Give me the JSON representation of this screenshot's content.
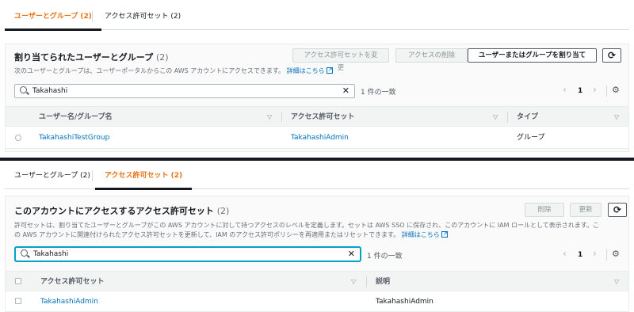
{
  "top": {
    "tabs": [
      {
        "label": "ユーザーとグループ (2)",
        "active": true
      },
      {
        "label": "アクセス許可セット (2)",
        "active": false
      }
    ],
    "title": "割り当てられたユーザーとグループ",
    "title_count": "(2)",
    "description": "次のユーザーとグループは、ユーザーポータルからこの AWS アカウントにアクセスできます。",
    "details_link": "詳細はこちら",
    "buttons": {
      "change_permission_set": "アクセス許可セットを変更",
      "remove_access": "アクセスの削除",
      "assign": "ユーザーまたはグループを割り当て",
      "refresh_icon": "refresh-icon"
    },
    "search": {
      "value": "Takahashi"
    },
    "match_count": "1 件の一致",
    "page": "1",
    "columns": [
      "ユーザー名/グループ名",
      "アクセス許可セット",
      "タイプ"
    ],
    "rows": [
      {
        "name": "TakahashiTestGroup",
        "permission_set": "TakahashiAdmin",
        "type": "グループ"
      }
    ]
  },
  "bottom": {
    "tabs": [
      {
        "label": "ユーザーとグループ (2)",
        "active": false
      },
      {
        "label": "アクセス許可セット (2)",
        "active": true
      }
    ],
    "title": "このアカウントにアクセスするアクセス許可セット",
    "title_count": "(2)",
    "description_line1": "許可セットは、割り当てたユーザーとグループがこの AWS アカウントに対して持つアクセスのレベルを定義します。セットは AWS SSO に保存され、このアカウントに IAM ロールとして表示されます。こ",
    "description_line2": "の AWS アカウントに関連付けられたアクセス許可セットを更新して、IAM のアクセス許可ポリシーを再適用またはリセットできます。",
    "details_link": "詳細はこちら",
    "buttons": {
      "delete": "削除",
      "update": "更新",
      "refresh_icon": "refresh-icon"
    },
    "search": {
      "value": "Takahashi"
    },
    "match_count": "1 件の一致",
    "page": "1",
    "columns": [
      "アクセス許可セット",
      "説明"
    ],
    "rows": [
      {
        "permission_set": "TakahashiAdmin",
        "description": "TakahashiAdmin"
      }
    ]
  },
  "colors": {
    "accent": "#ec7211",
    "link": "#0073bb",
    "focus": "#00a1c9"
  }
}
